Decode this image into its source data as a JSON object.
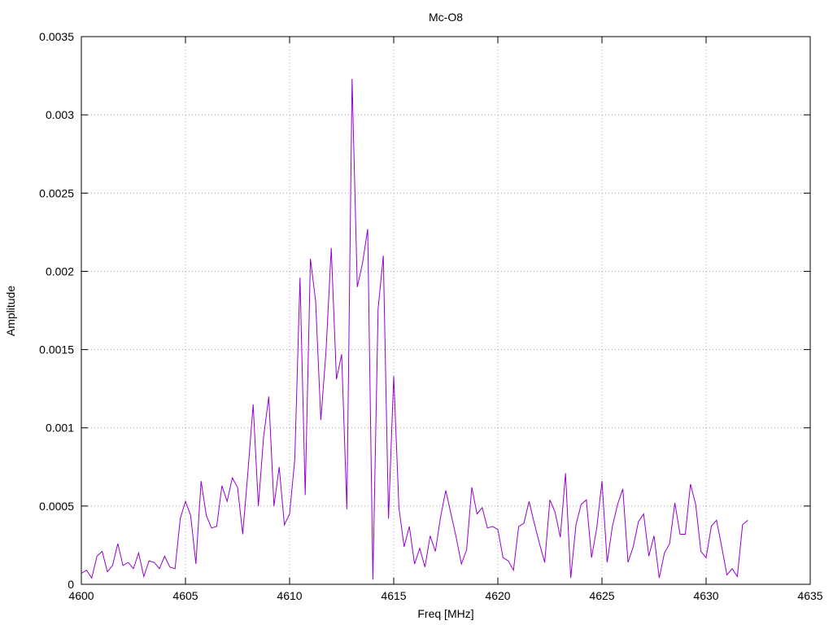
{
  "chart_data": {
    "type": "line",
    "title": "Mc-O8",
    "xlabel": "Freq [MHz]",
    "ylabel": "Amplitude",
    "xlim": [
      4600,
      4635
    ],
    "ylim": [
      0,
      0.0035
    ],
    "xticks": [
      4600,
      4605,
      4610,
      4615,
      4620,
      4625,
      4630,
      4635
    ],
    "xtick_labels": [
      "4600",
      "4605",
      "4610",
      "4615",
      "4620",
      "4625",
      "4630",
      "4635"
    ],
    "yticks": [
      0,
      0.0005,
      0.001,
      0.0015,
      0.002,
      0.0025,
      0.003,
      0.0035
    ],
    "ytick_labels": [
      "0",
      "0.0005",
      "0.001",
      "0.0015",
      "0.002",
      "0.0025",
      "0.003",
      "0.0035"
    ],
    "grid": true,
    "series": [
      {
        "color": "#9400d3",
        "x": [
          4600.0,
          4600.25,
          4600.5,
          4600.75,
          4601.0,
          4601.25,
          4601.5,
          4601.75,
          4602.0,
          4602.25,
          4602.5,
          4602.75,
          4603.0,
          4603.25,
          4603.5,
          4603.75,
          4604.0,
          4604.25,
          4604.5,
          4604.75,
          4605.0,
          4605.25,
          4605.5,
          4605.75,
          4606.0,
          4606.25,
          4606.5,
          4606.75,
          4607.0,
          4607.25,
          4607.5,
          4607.75,
          4608.0,
          4608.25,
          4608.5,
          4608.75,
          4609.0,
          4609.25,
          4609.5,
          4609.75,
          4610.0,
          4610.25,
          4610.5,
          4610.75,
          4611.0,
          4611.25,
          4611.5,
          4611.75,
          4612.0,
          4612.25,
          4612.5,
          4612.75,
          4613.0,
          4613.25,
          4613.5,
          4613.75,
          4614.0,
          4614.25,
          4614.5,
          4614.75,
          4615.0,
          4615.25,
          4615.5,
          4615.75,
          4616.0,
          4616.25,
          4616.5,
          4616.75,
          4617.0,
          4617.25,
          4617.5,
          4617.75,
          4618.0,
          4618.25,
          4618.5,
          4618.75,
          4619.0,
          4619.25,
          4619.5,
          4619.75,
          4620.0,
          4620.25,
          4620.5,
          4620.75,
          4621.0,
          4621.25,
          4621.5,
          4621.75,
          4622.0,
          4622.25,
          4622.5,
          4622.75,
          4623.0,
          4623.25,
          4623.5,
          4623.75,
          4624.0,
          4624.25,
          4624.5,
          4624.75,
          4625.0,
          4625.25,
          4625.5,
          4625.75,
          4626.0,
          4626.25,
          4626.5,
          4626.75,
          4627.0,
          4627.25,
          4627.5,
          4627.75,
          4628.0,
          4628.25,
          4628.5,
          4628.75,
          4629.0,
          4629.25,
          4629.5,
          4629.75,
          4630.0,
          4630.25,
          4630.5,
          4630.75,
          4631.0,
          4631.25,
          4631.5,
          4631.75,
          4632.0
        ],
        "y": [
          7e-05,
          9e-05,
          4e-05,
          0.00018,
          0.00021,
          8e-05,
          0.00012,
          0.00026,
          0.00012,
          0.00014,
          0.0001,
          0.0002,
          5e-05,
          0.00015,
          0.00014,
          0.0001,
          0.00018,
          0.00011,
          0.0001,
          0.00042,
          0.00053,
          0.00044,
          0.00013,
          0.00066,
          0.00044,
          0.00036,
          0.00037,
          0.00063,
          0.00053,
          0.00068,
          0.00062,
          0.00032,
          0.00072,
          0.00115,
          0.0005,
          0.00094,
          0.0012,
          0.0005,
          0.00075,
          0.00038,
          0.00045,
          0.0008,
          0.00196,
          0.00057,
          0.00208,
          0.00181,
          0.00105,
          0.00149,
          0.00215,
          0.00131,
          0.00147,
          0.00048,
          0.00323,
          0.0019,
          0.00205,
          0.00227,
          3e-05,
          0.00176,
          0.0021,
          0.00042,
          0.00133,
          0.00049,
          0.00024,
          0.00037,
          0.00013,
          0.00023,
          0.00011,
          0.00031,
          0.00021,
          0.00043,
          0.0006,
          0.00045,
          0.0003,
          0.00013,
          0.00022,
          0.00062,
          0.00045,
          0.00049,
          0.00036,
          0.00037,
          0.00035,
          0.00017,
          0.00015,
          9e-05,
          0.00037,
          0.00039,
          0.00053,
          0.00039,
          0.00026,
          0.00014,
          0.00054,
          0.00046,
          0.0003,
          0.00071,
          4e-05,
          0.00038,
          0.00051,
          0.00054,
          0.00017,
          0.00036,
          0.00066,
          0.00014,
          0.00037,
          0.00051,
          0.00061,
          0.00014,
          0.00024,
          0.0004,
          0.00045,
          0.00018,
          0.00031,
          4e-05,
          0.0002,
          0.00026,
          0.00052,
          0.00032,
          0.00032,
          0.00064,
          0.00051,
          0.00021,
          0.00017,
          0.00037,
          0.00041,
          0.00024,
          6e-05,
          0.0001,
          5e-05,
          0.00038,
          0.00041
        ]
      }
    ]
  }
}
